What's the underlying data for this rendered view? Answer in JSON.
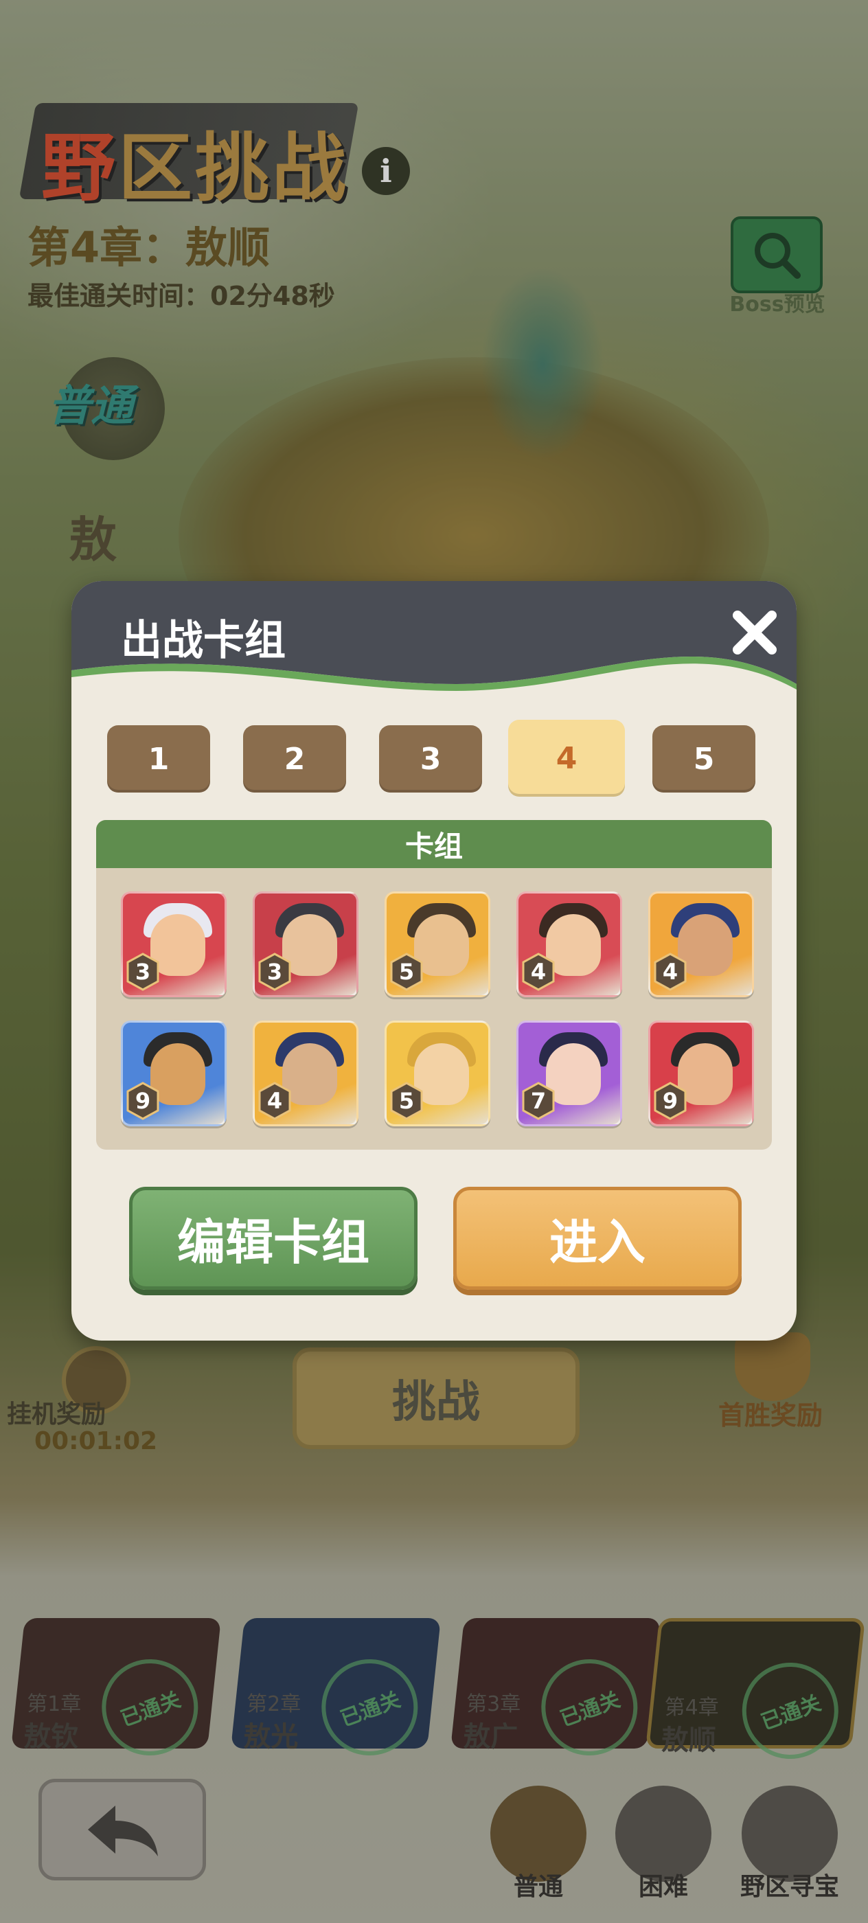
{
  "header": {
    "title_first": "野",
    "title_rest": "区挑战",
    "chapter_title": "第4章：敖顺",
    "best_time": "最佳通关时间：02分48秒",
    "boss_preview_label": "Boss预览",
    "mode_badge": "普通",
    "side_text": "敖"
  },
  "background": {
    "idle_reward_label": "挂机奖励",
    "idle_timer": "00:01:02",
    "challenge_label": "挑战",
    "first_win_label": "首胜奖励"
  },
  "chapters": [
    {
      "name": "第1章",
      "boss": "敖钦",
      "status": "已通关"
    },
    {
      "name": "第2章",
      "boss": "敖光",
      "status": "已通关"
    },
    {
      "name": "第3章",
      "boss": "敖广",
      "status": "已通关"
    },
    {
      "name": "第4章",
      "boss": "敖顺",
      "status": "已通关"
    }
  ],
  "bottom_nav": {
    "normal": "普通",
    "hard": "困难",
    "treasure": "野区寻宝"
  },
  "modal": {
    "title": "出战卡组",
    "tabs": [
      "1",
      "2",
      "3",
      "4",
      "5"
    ],
    "active_tab": "4",
    "deck_header": "卡组",
    "cards": [
      {
        "level": "3",
        "bg": "#d7464f",
        "hair": "#e8e8f0",
        "face": "#f2c49a"
      },
      {
        "level": "3",
        "bg": "#c8404a",
        "hair": "#3a3a42",
        "face": "#e8c29c"
      },
      {
        "level": "5",
        "bg": "#f0b03e",
        "hair": "#4a3a2a",
        "face": "#e9c08f"
      },
      {
        "level": "4",
        "bg": "#d84c55",
        "hair": "#3b2a22",
        "face": "#f1c9a3"
      },
      {
        "level": "4",
        "bg": "#f0a63c",
        "hair": "#2e3f7a",
        "face": "#d9a277"
      },
      {
        "level": "9",
        "bg": "#4f85d9",
        "hair": "#2b2b2b",
        "face": "#d9a060"
      },
      {
        "level": "4",
        "bg": "#f0b23e",
        "hair": "#2c3a6a",
        "face": "#d9b089"
      },
      {
        "level": "5",
        "bg": "#f2c24a",
        "hair": "#d9a73c",
        "face": "#f3d2a5"
      },
      {
        "level": "7",
        "bg": "#a35fd6",
        "hair": "#2a2a4a",
        "face": "#f4d2c0"
      },
      {
        "level": "9",
        "bg": "#d8404a",
        "hair": "#2a2a2a",
        "face": "#e9b58c"
      }
    ],
    "edit_button": "编辑卡组",
    "enter_button": "进入"
  }
}
